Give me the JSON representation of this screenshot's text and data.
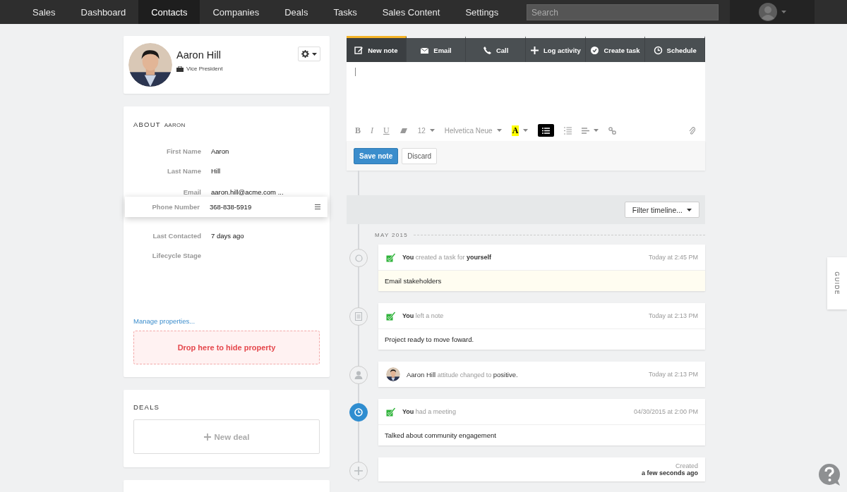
{
  "nav": {
    "items": [
      {
        "label": "Sales",
        "selected": false
      },
      {
        "label": "Dashboard",
        "selected": false
      },
      {
        "label": "Contacts",
        "selected": true
      },
      {
        "label": "Companies",
        "selected": false
      },
      {
        "label": "Deals",
        "selected": false
      },
      {
        "label": "Tasks",
        "selected": false
      },
      {
        "label": "Sales Content",
        "selected": false
      },
      {
        "label": "Settings",
        "selected": false
      }
    ],
    "search": {
      "placeholder": "Search"
    }
  },
  "contact": {
    "name": "Aaron Hill",
    "title": "Vice President"
  },
  "about": {
    "heading": "ABOUT",
    "heading_name": "AARON",
    "properties": [
      {
        "label": "First Name",
        "value": "Aaron"
      },
      {
        "label": "Last Name",
        "value": "Hill"
      },
      {
        "label": "Email",
        "value": "aaron.hill@acme.com ..."
      },
      {
        "label": "Last Contacted",
        "value": "7 days ago"
      },
      {
        "label": "Lifecycle Stage"
      }
    ],
    "dragged_property": {
      "label": "Phone Number",
      "value": "368-838-5919"
    },
    "manage_link": "Manage properties...",
    "drop_zone": "Drop here to hide property"
  },
  "deals": {
    "heading": "DEALS",
    "new_button": "New deal"
  },
  "composer": {
    "tabs": [
      {
        "label": "New note",
        "kind": "note",
        "selected": true
      },
      {
        "label": "Email",
        "kind": "email",
        "selected": false
      },
      {
        "label": "Call",
        "kind": "call",
        "selected": false
      },
      {
        "label": "Log activity",
        "kind": "plus",
        "selected": false
      },
      {
        "label": "Create task",
        "kind": "task",
        "selected": false
      },
      {
        "label": "Schedule",
        "kind": "clock",
        "selected": false
      }
    ],
    "format": {
      "bold": "B",
      "italic": "I",
      "underline": "U",
      "font_size": "12",
      "font_family": "Helvetica Neue",
      "text_color": "A",
      "bulleted_list_selected": true
    },
    "save_button": "Save note",
    "discard_button": "Discard"
  },
  "timeline": {
    "filter_button": "Filter timeline...",
    "month": "MAY 2015",
    "entries": [
      {
        "kind": "task",
        "summary": "**You** created a task for **yourself**",
        "time": "Today at 2:45 PM",
        "body": "Email stakeholders",
        "highlighted": false
      },
      {
        "kind": "note",
        "summary": "**You** left a note",
        "time": "Today at 2:13 PM",
        "body": "Project ready to move foward.",
        "highlighted": false
      },
      {
        "kind": "attitude",
        "summary": "**Aaron Hill** attitude changed to **positive.**",
        "time": "Today at 2:13 PM",
        "highlighted": false
      },
      {
        "kind": "meeting",
        "summary": "**You** had a meeting",
        "time": "04/30/2015 at 2:00 PM",
        "body": "Talked about community engagement",
        "highlighted": true
      },
      {
        "kind": "created",
        "summary": "Created **a few seconds ago**",
        "highlighted": false
      }
    ]
  },
  "guide_tab": "GUIDE"
}
